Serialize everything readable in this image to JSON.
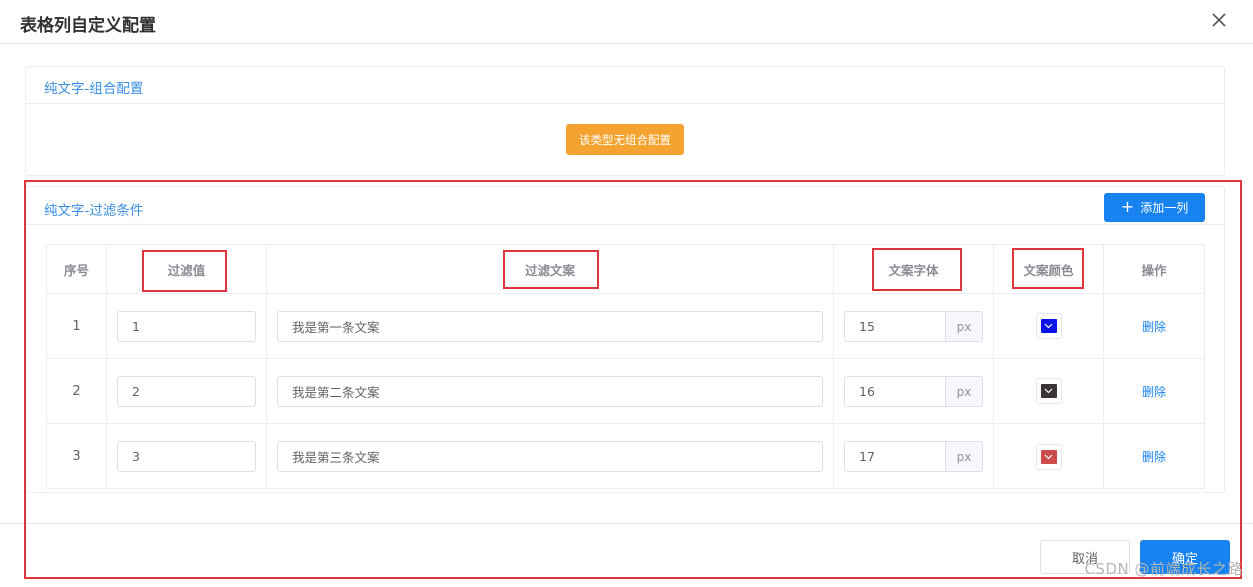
{
  "dialog": {
    "title": "表格列自定义配置",
    "close_icon": "close-icon"
  },
  "group_card": {
    "title": "纯文字-组合配置",
    "notice_button": "该类型无组合配置"
  },
  "filter_card": {
    "title": "纯文字-过滤条件",
    "add_button_icon": "plus-icon",
    "add_button": "添加一列",
    "headers": {
      "index": "序号",
      "filter_value": "过滤值",
      "filter_text": "过滤文案",
      "font_size": "文案字体",
      "font_color": "文案颜色",
      "actions": "操作"
    },
    "rows": [
      {
        "index": "1",
        "filter_value": "1",
        "filter_text": "我是第一条文案",
        "font_size": "15",
        "unit": "px",
        "color": "#0a14e8",
        "action": "删除"
      },
      {
        "index": "2",
        "filter_value": "2",
        "filter_text": "我是第二条文案",
        "font_size": "16",
        "unit": "px",
        "color": "#3a3434",
        "action": "删除"
      },
      {
        "index": "3",
        "filter_value": "3",
        "filter_text": "我是第三条文案",
        "font_size": "17",
        "unit": "px",
        "color": "#cc4b4b",
        "action": "删除"
      }
    ]
  },
  "footer": {
    "cancel": "取消",
    "confirm": "确定"
  },
  "watermark": "CSDN @前端成长之路",
  "colors": {
    "accent": "#1883f0",
    "warning": "#f5a330",
    "highlight": "#e0363b",
    "card_title": "#3a8ee6"
  }
}
